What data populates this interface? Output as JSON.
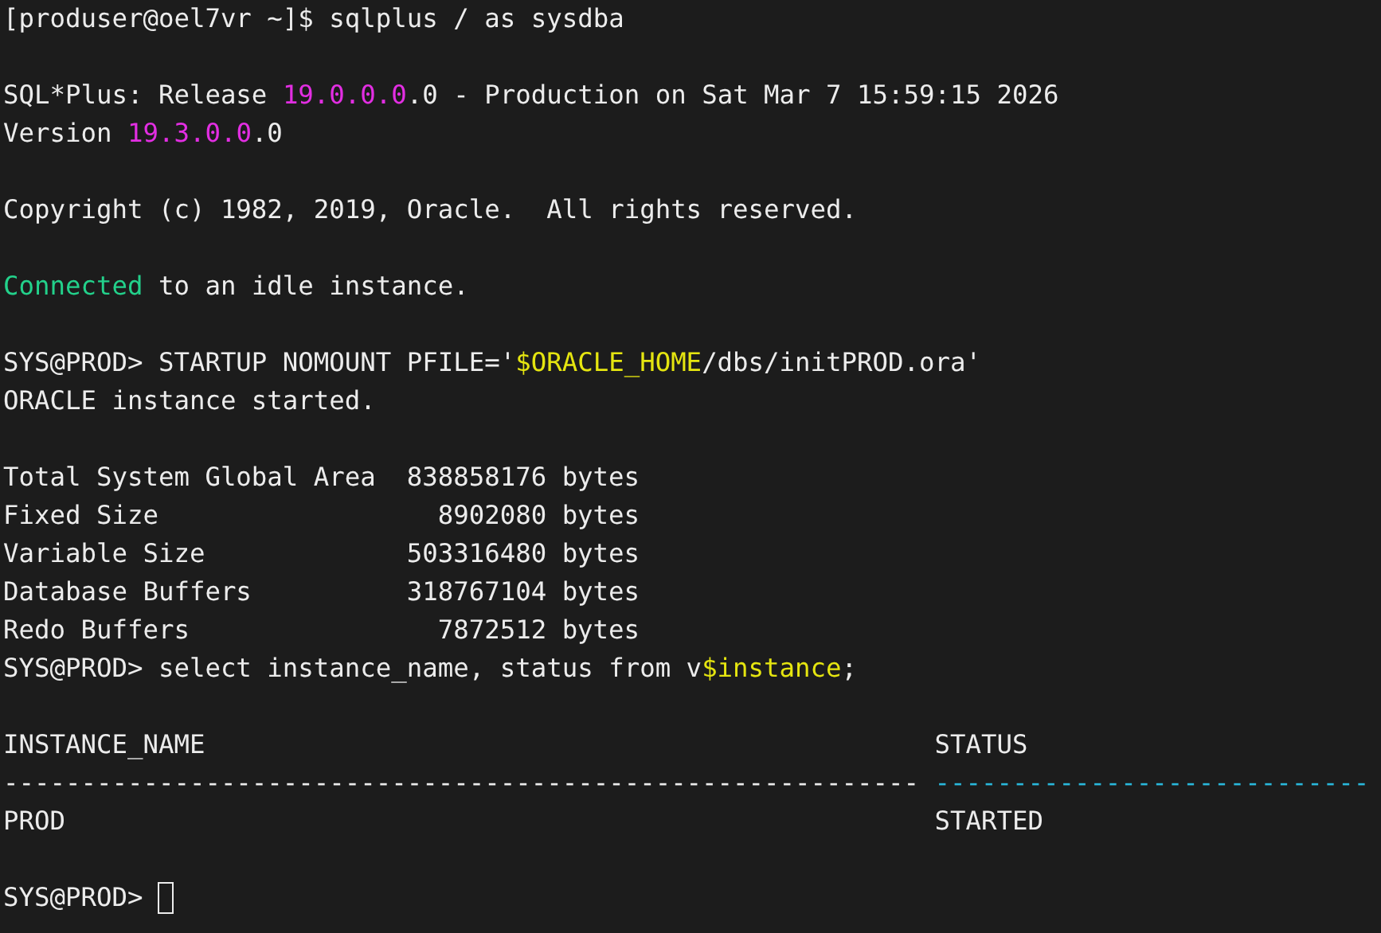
{
  "terminal": [
    {
      "kind": "line",
      "segments": [
        {
          "text": "[produser@oel7vr ~]$ sqlplus / as sysdba"
        }
      ]
    },
    {
      "kind": "blank"
    },
    {
      "kind": "line",
      "segments": [
        {
          "text": "SQL*Plus: Release "
        },
        {
          "text": "19.0.0.0",
          "color": "#e22ee2"
        },
        {
          "text": ".0 - Production on Sat Mar 7 15:59:15 2026"
        }
      ]
    },
    {
      "kind": "line",
      "segments": [
        {
          "text": "Version "
        },
        {
          "text": "19.3.0.0",
          "color": "#e22ee2"
        },
        {
          "text": ".0"
        }
      ]
    },
    {
      "kind": "blank"
    },
    {
      "kind": "line",
      "segments": [
        {
          "text": "Copyright (c) 1982, 2019, Oracle.  All rights reserved."
        }
      ]
    },
    {
      "kind": "blank"
    },
    {
      "kind": "line",
      "segments": [
        {
          "text": "Connected",
          "color": "#23d18b"
        },
        {
          "text": " to an idle instance."
        }
      ]
    },
    {
      "kind": "blank"
    },
    {
      "kind": "line",
      "segments": [
        {
          "text": "SYS@PROD> STARTUP NOMOUNT PFILE='"
        },
        {
          "text": "$ORACLE_HOME",
          "color": "#e5e510"
        },
        {
          "text": "/dbs/initPROD.ora'"
        }
      ]
    },
    {
      "kind": "line",
      "segments": [
        {
          "text": "ORACLE instance started."
        }
      ]
    },
    {
      "kind": "blank"
    },
    {
      "kind": "memory",
      "label": "Total System Global Area",
      "value": "838858176",
      "unit": "bytes"
    },
    {
      "kind": "memory",
      "label": "Fixed Size",
      "value": "8902080",
      "unit": "bytes"
    },
    {
      "kind": "memory",
      "label": "Variable Size",
      "value": "503316480",
      "unit": "bytes"
    },
    {
      "kind": "memory",
      "label": "Database Buffers",
      "value": "318767104",
      "unit": "bytes"
    },
    {
      "kind": "memory",
      "label": "Redo Buffers",
      "value": "7872512",
      "unit": "bytes"
    },
    {
      "kind": "line",
      "segments": [
        {
          "text": "SYS@PROD> select instance_name, status from v"
        },
        {
          "text": "$instance",
          "color": "#e5e510"
        },
        {
          "text": ";"
        }
      ]
    },
    {
      "kind": "blank"
    },
    {
      "kind": "result",
      "columns": [
        {
          "heading": "INSTANCE_NAME",
          "rule": "-----------------------------------------------------------"
        },
        {
          "heading": "STATUS",
          "rule": "----------------------------",
          "color": "#29b8db"
        }
      ],
      "rows": [
        [
          "PROD",
          "STARTED"
        ]
      ]
    },
    {
      "kind": "blank"
    },
    {
      "kind": "prompt",
      "text": "SYS@PROD>"
    }
  ]
}
